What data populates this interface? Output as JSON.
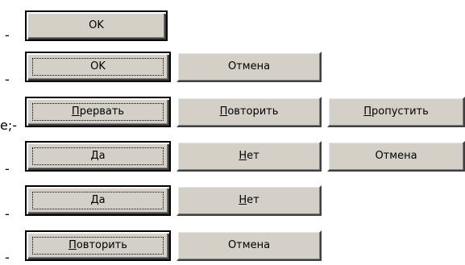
{
  "dash": "-",
  "stray_text": "e;-",
  "rows": [
    {
      "buttons": [
        {
          "label": "OK",
          "mnemonic": ""
        }
      ]
    },
    {
      "buttons": [
        {
          "label": "OK",
          "mnemonic": ""
        },
        {
          "label": "Отмена",
          "mnemonic": ""
        }
      ]
    },
    {
      "buttons": [
        {
          "label_first": "П",
          "label_rest": "рервать"
        },
        {
          "label_first": "П",
          "label_rest": "овторить"
        },
        {
          "label_first": "П",
          "label_rest": "ропустить"
        }
      ]
    },
    {
      "buttons": [
        {
          "label_first": "Д",
          "label_rest": "а"
        },
        {
          "label_first": "Н",
          "label_rest": "ет"
        },
        {
          "label": "Отмена"
        }
      ]
    },
    {
      "buttons": [
        {
          "label_first": "Д",
          "label_rest": "а"
        },
        {
          "label_first": "Н",
          "label_rest": "ет"
        }
      ]
    },
    {
      "buttons": [
        {
          "label_first": "П",
          "label_rest": "овторить"
        },
        {
          "label": "Отмена"
        }
      ]
    }
  ],
  "colors": {
    "button_face": "#d4d0c8",
    "background": "#ffffff"
  }
}
